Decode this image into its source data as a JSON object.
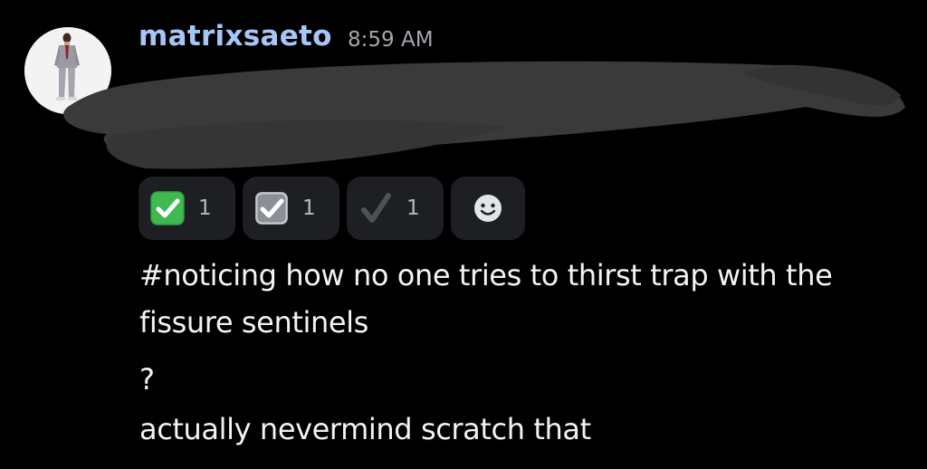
{
  "message": {
    "author": "matrixsaeto",
    "timestamp": "8:59 AM",
    "reactions": [
      {
        "emoji": "green-check-box-icon",
        "count": "1"
      },
      {
        "emoji": "gray-check-box-icon",
        "count": "1"
      },
      {
        "emoji": "check-mark-icon",
        "count": "1"
      }
    ]
  },
  "followups": [
    "#noticing how no one tries to thirst trap with the",
    "fissure sentinels",
    "?",
    "actually nevermind scratch that"
  ],
  "colors": {
    "background": "#000000",
    "username": "#a7c6f8",
    "timestamp": "#a3a6ad",
    "reaction_bg": "#1e1f22",
    "text": "#f2f3f5"
  }
}
